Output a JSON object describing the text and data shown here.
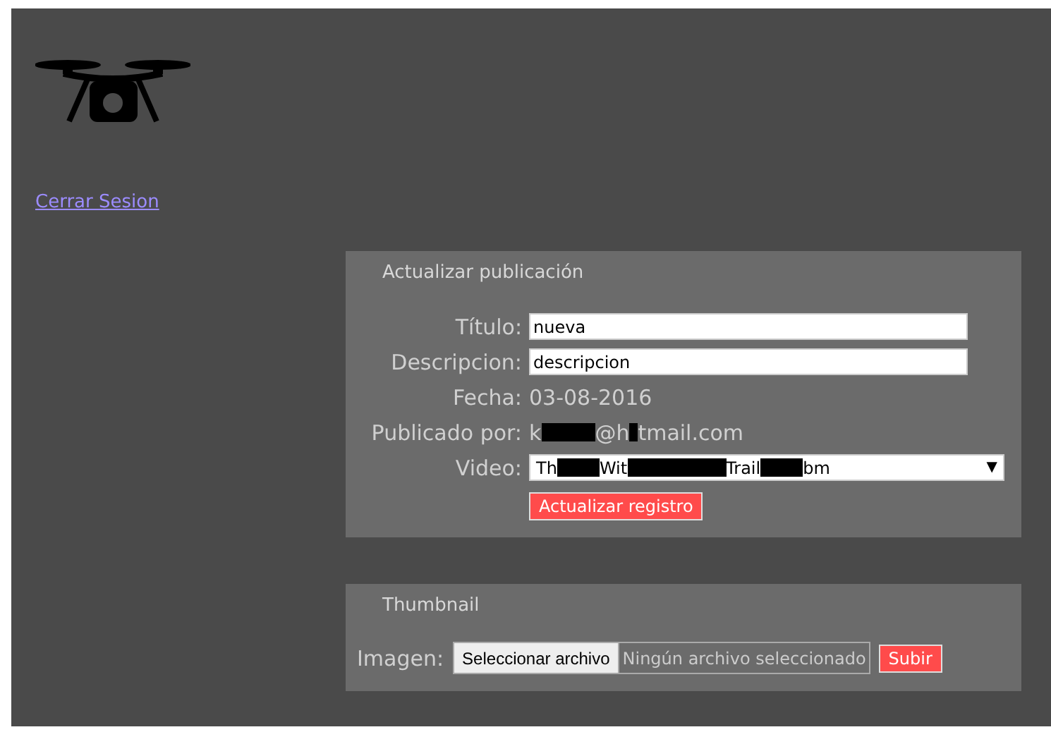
{
  "sidebar": {
    "logout_link": "Cerrar Sesion"
  },
  "update_form": {
    "title": "Actualizar publicación",
    "fields": [
      {
        "kind": "input",
        "label": "Título:",
        "value": "nueva"
      },
      {
        "kind": "input",
        "label": "Descripcion:",
        "value": "descripcion"
      },
      {
        "kind": "text",
        "label": "Fecha:",
        "value": "03-08-2016"
      },
      {
        "kind": "redacted",
        "label": "Publicado por:",
        "parts": [
          "k",
          "@h",
          "tmail.com"
        ]
      },
      {
        "kind": "select",
        "label": "Video:",
        "parts": [
          "Th",
          "Wit",
          "Trail",
          "bm"
        ],
        "arrow": "▼"
      }
    ],
    "submit": "Actualizar registro"
  },
  "thumbnail_form": {
    "title": "Thumbnail",
    "label": "Imagen:",
    "choose_button": "Seleccionar archivo",
    "file_status": "Ningún archivo seleccionado",
    "submit": "Subir"
  }
}
